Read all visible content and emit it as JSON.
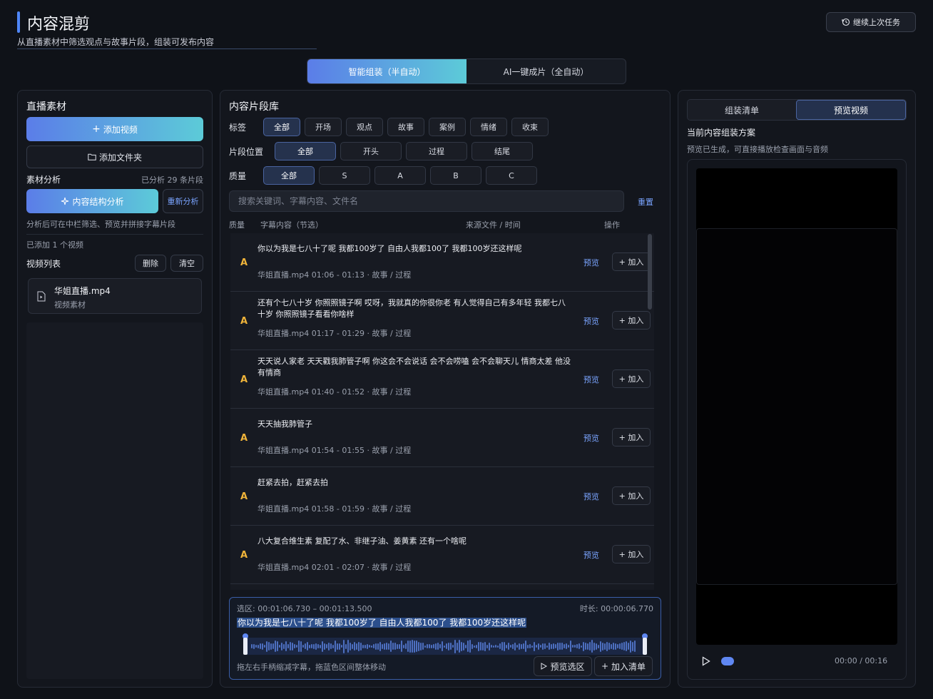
{
  "header": {
    "title": "内容混剪",
    "subtitle": "从直播素材中筛选观点与故事片段，组装可发布内容",
    "resume_label": "继续上次任务"
  },
  "mode_tabs": [
    {
      "label": "智能组装（半自动）",
      "active": true
    },
    {
      "label": "AI一键成片（全自动）",
      "active": false
    }
  ],
  "left": {
    "title": "直播素材",
    "add_video": "添加视频",
    "add_folder": "添加文件夹",
    "analysis_title": "素材分析",
    "analysis_count": "已分析 29 条片段",
    "analyze_btn": "内容结构分析",
    "reanalyze_btn": "重新分析",
    "hint": "分析后可在中栏筛选、预览并拼接字幕片段",
    "added_count": "已添加 1 个视频",
    "list_title": "视频列表",
    "delete_btn": "删除",
    "clear_btn": "清空",
    "videos": [
      {
        "name": "华姐直播.mp4",
        "type": "视频素材"
      }
    ]
  },
  "mid": {
    "title": "内容片段库",
    "tag_label": "标签",
    "tags": [
      "全部",
      "开场",
      "观点",
      "故事",
      "案例",
      "情绪",
      "收束"
    ],
    "position_label": "片段位置",
    "positions": [
      "全部",
      "开头",
      "过程",
      "结尾"
    ],
    "quality_label": "质量",
    "qualities": [
      "全部",
      "S",
      "A",
      "B",
      "C"
    ],
    "search_placeholder": "搜索关键词、字幕内容、文件名",
    "reset": "重置",
    "col_quality": "质量",
    "col_text": "字幕内容（节选）",
    "col_source": "来源文件 / 时间",
    "col_action": "操作",
    "preview_label": "预览",
    "add_label": "+ 加入",
    "rows": [
      {
        "q": "A",
        "text": "你以为我是七八十了呢 我都100岁了 自由人我都100了 我都100岁还这样呢",
        "meta": "华姐直播.mp4   01:06 - 01:13   ·   故事 / 过程"
      },
      {
        "q": "A",
        "text": "还有个七八十岁 你照照镜子啊 哎呀，我就真的你很你老 有人觉得自己有多年轻 我都七八十岁 你照照镜子看看你啥样",
        "meta": "华姐直播.mp4   01:17 - 01:29   ·   故事 / 过程"
      },
      {
        "q": "A",
        "text": "天天说人家老 天天戳我肺管子啊 你这会不会说话 会不会唠嗑 会不会聊天儿 情商太差 他没有情商",
        "meta": "华姐直播.mp4   01:40 - 01:52   ·   故事 / 过程"
      },
      {
        "q": "A",
        "text": "天天抽我肺管子",
        "meta": "华姐直播.mp4   01:54 - 01:55   ·   故事 / 过程"
      },
      {
        "q": "A",
        "text": "赶紧去拍，赶紧去拍",
        "meta": "华姐直播.mp4   01:58 - 01:59   ·   故事 / 过程"
      },
      {
        "q": "A",
        "text": "八大复合维生素 复配了水、非继子油、姜黄素 还有一个啥呢",
        "meta": "华姐直播.mp4   02:01 - 02:07   ·   故事 / 过程"
      }
    ],
    "selection": {
      "range": "选区: 00:01:06.730 – 00:01:13.500",
      "duration": "时长: 00:00:06.770",
      "text": "你以为我是七八十了呢 我都100岁了 自由人我都100了 我都100岁还这样呢",
      "hint": "拖左右手柄缩减字幕，拖蓝色区间整体移动",
      "preview_btn": "预览选区",
      "add_btn": "加入清单"
    }
  },
  "right": {
    "tabs": [
      {
        "label": "组装清单",
        "active": false
      },
      {
        "label": "预览视频",
        "active": true
      }
    ],
    "plan_title": "当前内容组装方案",
    "plan_hint": "预览已生成，可直接播放检查画面与音频",
    "time": "00:00 / 00:16"
  },
  "colors": {
    "accent": "#4f86f7",
    "gradient_start": "#5b7de8",
    "gradient_end": "#5ccbd8",
    "quality_a": "#f0b43a",
    "link": "#7aa4ff"
  }
}
